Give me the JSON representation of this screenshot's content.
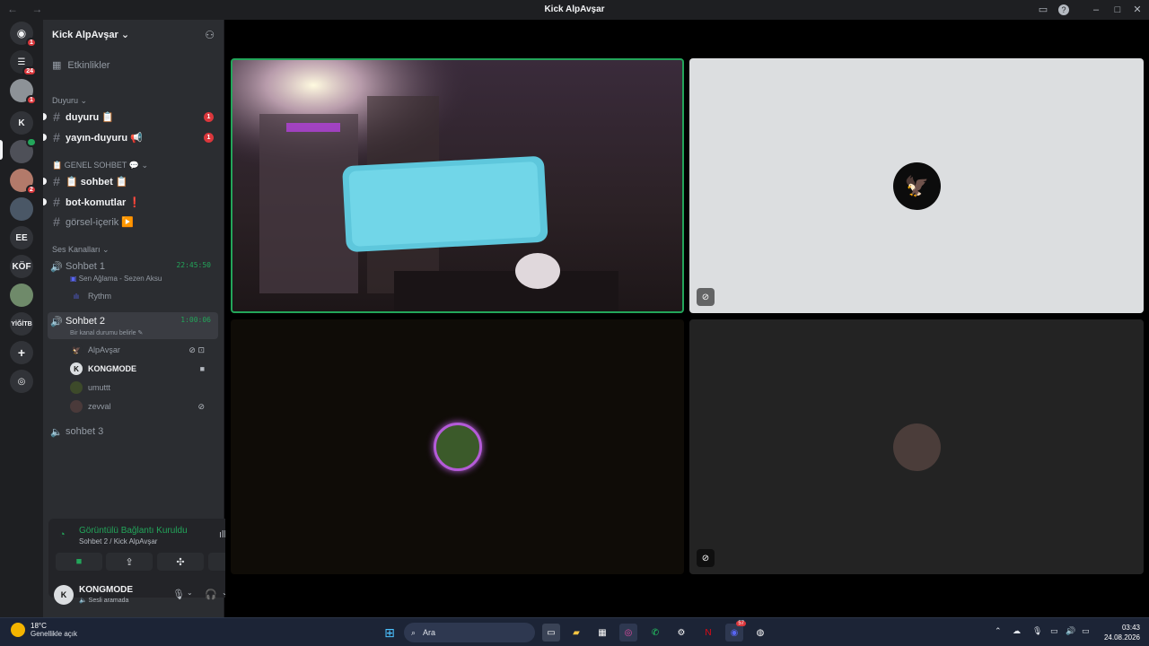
{
  "window": {
    "title": "Kick AlpAvşar",
    "nav_label": "← →"
  },
  "rail": {
    "servers": [
      {
        "label": "",
        "badge": "1"
      },
      {
        "label": "",
        "badge": "24"
      },
      {
        "label": "",
        "badge": "1"
      },
      {
        "label": "K",
        "badge": ""
      },
      {
        "label": "",
        "badge": ""
      },
      {
        "label": "",
        "badge": "2"
      },
      {
        "label": "",
        "badge": ""
      },
      {
        "label": "",
        "badge": ""
      },
      {
        "label": "EE",
        "badge": ""
      },
      {
        "label": "KÖF",
        "badge": ""
      },
      {
        "label": "",
        "badge": ""
      },
      {
        "label": "YİĞİTB",
        "badge": ""
      }
    ]
  },
  "sidebar": {
    "guild_name": "Kick AlpAvşar",
    "events": "Etkinlikler",
    "categories": {
      "announcements": "Duyuru",
      "general": "📋 GENEL SOHBET 💬",
      "voice": "Ses Kanalları"
    },
    "channels": [
      {
        "name": "duyuru 📋",
        "mention": "1"
      },
      {
        "name": "yayın-duyuru 📢",
        "mention": "1"
      },
      {
        "name": "📋 sohbet 📋",
        "mention": ""
      },
      {
        "name": "bot-komutlar ❗",
        "mention": ""
      },
      {
        "name": "görsel-içerik ▶️",
        "mention": ""
      }
    ],
    "voice_channels": {
      "sohbet1": {
        "name": "Sohbet 1",
        "timer": "22:45:50",
        "activity": "Sen Ağlama - Sezen Aksu",
        "member": "Rythm"
      },
      "sohbet2": {
        "name": "Sohbet 2",
        "timer": "1:00:06",
        "status_hint": "Bir kanal durumu belirle",
        "members": [
          "AlpAvşar",
          "KONGMODE",
          "umuttt",
          "zevval"
        ]
      },
      "sohbet3": {
        "name": "sohbet 3"
      }
    }
  },
  "voice_panel": {
    "status": "Görüntülü Bağlantı Kuruldu",
    "path": "Sohbet 2 / Kick AlpAvşar"
  },
  "user": {
    "name": "KONGMODE",
    "status": "Sesli aramada"
  },
  "taskbar": {
    "temperature": "18°C",
    "weather": "Genellikle açık",
    "search_placeholder": "Ara",
    "time": "03:43",
    "date": "24.08.2026",
    "discord_badge": "57"
  },
  "colors": {
    "accent_green": "#23a55a",
    "mention_red": "#da373c",
    "speaking_ring": "#b45bd8"
  }
}
